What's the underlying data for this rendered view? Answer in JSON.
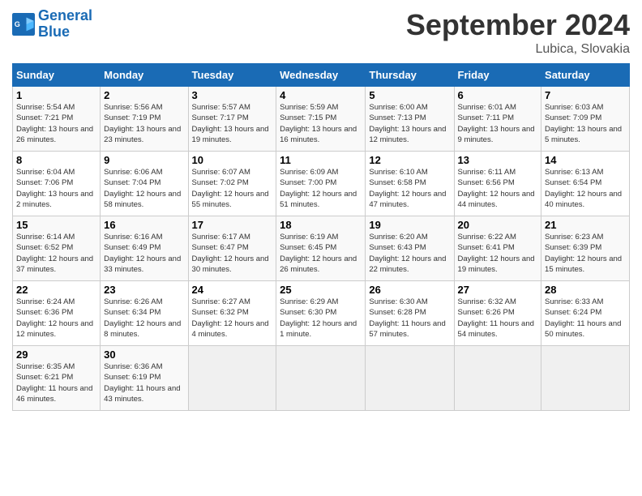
{
  "header": {
    "logo_line1": "General",
    "logo_line2": "Blue",
    "month": "September 2024",
    "location": "Lubica, Slovakia"
  },
  "days_of_week": [
    "Sunday",
    "Monday",
    "Tuesday",
    "Wednesday",
    "Thursday",
    "Friday",
    "Saturday"
  ],
  "weeks": [
    [
      {
        "num": "1",
        "sunrise": "Sunrise: 5:54 AM",
        "sunset": "Sunset: 7:21 PM",
        "daylight": "Daylight: 13 hours and 26 minutes."
      },
      {
        "num": "2",
        "sunrise": "Sunrise: 5:56 AM",
        "sunset": "Sunset: 7:19 PM",
        "daylight": "Daylight: 13 hours and 23 minutes."
      },
      {
        "num": "3",
        "sunrise": "Sunrise: 5:57 AM",
        "sunset": "Sunset: 7:17 PM",
        "daylight": "Daylight: 13 hours and 19 minutes."
      },
      {
        "num": "4",
        "sunrise": "Sunrise: 5:59 AM",
        "sunset": "Sunset: 7:15 PM",
        "daylight": "Daylight: 13 hours and 16 minutes."
      },
      {
        "num": "5",
        "sunrise": "Sunrise: 6:00 AM",
        "sunset": "Sunset: 7:13 PM",
        "daylight": "Daylight: 13 hours and 12 minutes."
      },
      {
        "num": "6",
        "sunrise": "Sunrise: 6:01 AM",
        "sunset": "Sunset: 7:11 PM",
        "daylight": "Daylight: 13 hours and 9 minutes."
      },
      {
        "num": "7",
        "sunrise": "Sunrise: 6:03 AM",
        "sunset": "Sunset: 7:09 PM",
        "daylight": "Daylight: 13 hours and 5 minutes."
      }
    ],
    [
      {
        "num": "8",
        "sunrise": "Sunrise: 6:04 AM",
        "sunset": "Sunset: 7:06 PM",
        "daylight": "Daylight: 13 hours and 2 minutes."
      },
      {
        "num": "9",
        "sunrise": "Sunrise: 6:06 AM",
        "sunset": "Sunset: 7:04 PM",
        "daylight": "Daylight: 12 hours and 58 minutes."
      },
      {
        "num": "10",
        "sunrise": "Sunrise: 6:07 AM",
        "sunset": "Sunset: 7:02 PM",
        "daylight": "Daylight: 12 hours and 55 minutes."
      },
      {
        "num": "11",
        "sunrise": "Sunrise: 6:09 AM",
        "sunset": "Sunset: 7:00 PM",
        "daylight": "Daylight: 12 hours and 51 minutes."
      },
      {
        "num": "12",
        "sunrise": "Sunrise: 6:10 AM",
        "sunset": "Sunset: 6:58 PM",
        "daylight": "Daylight: 12 hours and 47 minutes."
      },
      {
        "num": "13",
        "sunrise": "Sunrise: 6:11 AM",
        "sunset": "Sunset: 6:56 PM",
        "daylight": "Daylight: 12 hours and 44 minutes."
      },
      {
        "num": "14",
        "sunrise": "Sunrise: 6:13 AM",
        "sunset": "Sunset: 6:54 PM",
        "daylight": "Daylight: 12 hours and 40 minutes."
      }
    ],
    [
      {
        "num": "15",
        "sunrise": "Sunrise: 6:14 AM",
        "sunset": "Sunset: 6:52 PM",
        "daylight": "Daylight: 12 hours and 37 minutes."
      },
      {
        "num": "16",
        "sunrise": "Sunrise: 6:16 AM",
        "sunset": "Sunset: 6:49 PM",
        "daylight": "Daylight: 12 hours and 33 minutes."
      },
      {
        "num": "17",
        "sunrise": "Sunrise: 6:17 AM",
        "sunset": "Sunset: 6:47 PM",
        "daylight": "Daylight: 12 hours and 30 minutes."
      },
      {
        "num": "18",
        "sunrise": "Sunrise: 6:19 AM",
        "sunset": "Sunset: 6:45 PM",
        "daylight": "Daylight: 12 hours and 26 minutes."
      },
      {
        "num": "19",
        "sunrise": "Sunrise: 6:20 AM",
        "sunset": "Sunset: 6:43 PM",
        "daylight": "Daylight: 12 hours and 22 minutes."
      },
      {
        "num": "20",
        "sunrise": "Sunrise: 6:22 AM",
        "sunset": "Sunset: 6:41 PM",
        "daylight": "Daylight: 12 hours and 19 minutes."
      },
      {
        "num": "21",
        "sunrise": "Sunrise: 6:23 AM",
        "sunset": "Sunset: 6:39 PM",
        "daylight": "Daylight: 12 hours and 15 minutes."
      }
    ],
    [
      {
        "num": "22",
        "sunrise": "Sunrise: 6:24 AM",
        "sunset": "Sunset: 6:36 PM",
        "daylight": "Daylight: 12 hours and 12 minutes."
      },
      {
        "num": "23",
        "sunrise": "Sunrise: 6:26 AM",
        "sunset": "Sunset: 6:34 PM",
        "daylight": "Daylight: 12 hours and 8 minutes."
      },
      {
        "num": "24",
        "sunrise": "Sunrise: 6:27 AM",
        "sunset": "Sunset: 6:32 PM",
        "daylight": "Daylight: 12 hours and 4 minutes."
      },
      {
        "num": "25",
        "sunrise": "Sunrise: 6:29 AM",
        "sunset": "Sunset: 6:30 PM",
        "daylight": "Daylight: 12 hours and 1 minute."
      },
      {
        "num": "26",
        "sunrise": "Sunrise: 6:30 AM",
        "sunset": "Sunset: 6:28 PM",
        "daylight": "Daylight: 11 hours and 57 minutes."
      },
      {
        "num": "27",
        "sunrise": "Sunrise: 6:32 AM",
        "sunset": "Sunset: 6:26 PM",
        "daylight": "Daylight: 11 hours and 54 minutes."
      },
      {
        "num": "28",
        "sunrise": "Sunrise: 6:33 AM",
        "sunset": "Sunset: 6:24 PM",
        "daylight": "Daylight: 11 hours and 50 minutes."
      }
    ],
    [
      {
        "num": "29",
        "sunrise": "Sunrise: 6:35 AM",
        "sunset": "Sunset: 6:21 PM",
        "daylight": "Daylight: 11 hours and 46 minutes."
      },
      {
        "num": "30",
        "sunrise": "Sunrise: 6:36 AM",
        "sunset": "Sunset: 6:19 PM",
        "daylight": "Daylight: 11 hours and 43 minutes."
      },
      null,
      null,
      null,
      null,
      null
    ]
  ]
}
